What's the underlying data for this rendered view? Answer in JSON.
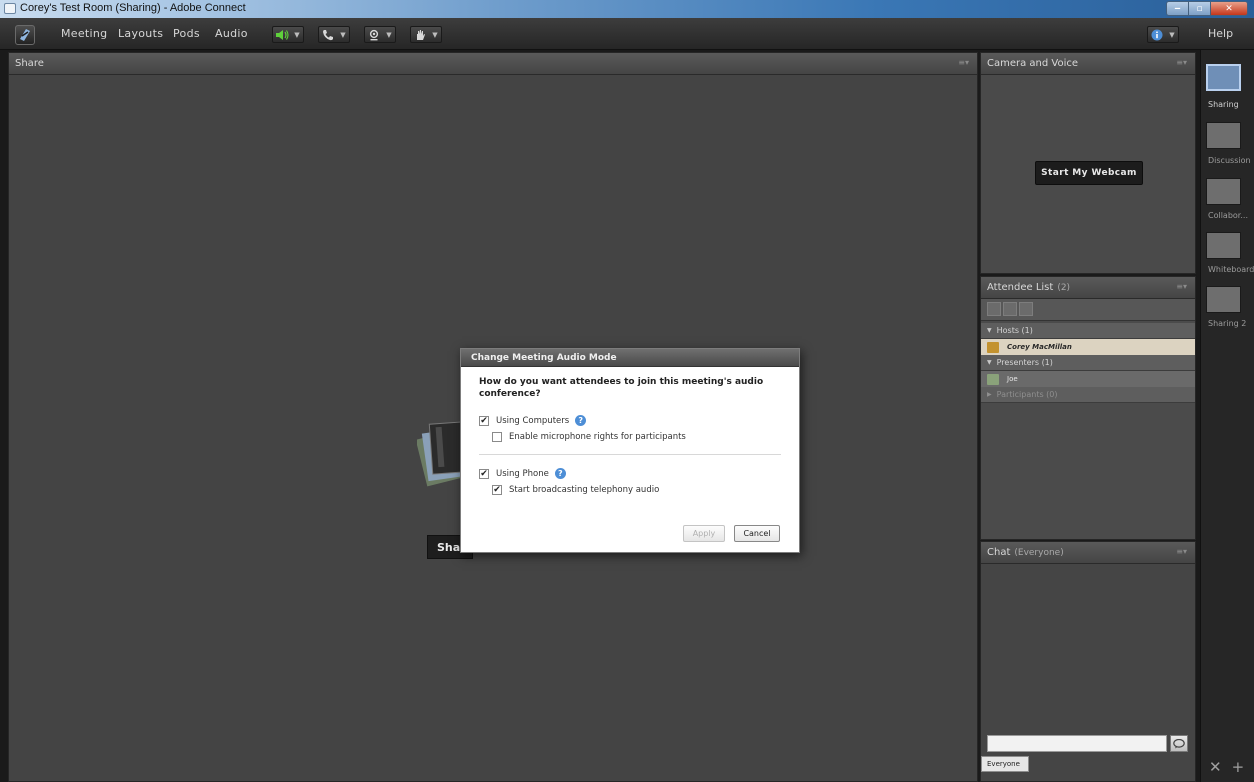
{
  "window": {
    "title": "Corey's Test Room (Sharing) - Adobe Connect"
  },
  "menubar": {
    "items": [
      "Meeting",
      "Layouts",
      "Pods",
      "Audio"
    ],
    "help": "Help"
  },
  "colors": {
    "accent": "#4d8ed6",
    "speaker_on": "#5fd13b"
  },
  "share_pod": {
    "title": "Share",
    "share_button": "Share"
  },
  "camera_pod": {
    "title": "Camera and Voice",
    "webcam_button": "Start My Webcam"
  },
  "attendee_pod": {
    "title": "Attendee List",
    "count": "(2)",
    "hosts_label": "Hosts (1)",
    "host_name": "Corey MacMillan",
    "presenters_label": "Presenters (1)",
    "presenter_name": "Joe",
    "participants_label": "Participants (0)"
  },
  "chat_pod": {
    "title": "Chat",
    "scope": "(Everyone)",
    "tab": "Everyone",
    "input_value": ""
  },
  "layouts": [
    {
      "label": "Sharing",
      "active": true
    },
    {
      "label": "Discussion",
      "active": false
    },
    {
      "label": "Collabor...",
      "active": false
    },
    {
      "label": "Whiteboard",
      "active": false
    },
    {
      "label": "Sharing 2",
      "active": false
    }
  ],
  "dialog": {
    "title": "Change Meeting Audio Mode",
    "question": "How do you want attendees to join this meeting's audio conference?",
    "using_computers": "Using Computers",
    "using_computers_checked": true,
    "enable_mic": "Enable microphone rights for participants",
    "enable_mic_checked": false,
    "using_phone": "Using Phone",
    "using_phone_checked": true,
    "start_broadcast": "Start broadcasting telephony audio",
    "start_broadcast_checked": true,
    "apply": "Apply",
    "cancel": "Cancel"
  }
}
